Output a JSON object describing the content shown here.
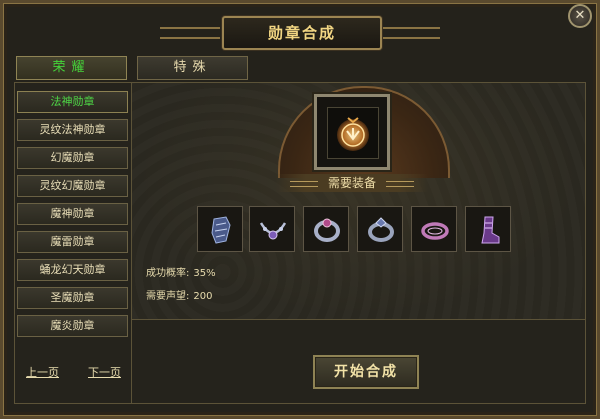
{
  "window": {
    "title": "勋章合成",
    "close_label": "✕"
  },
  "tabs": [
    {
      "label": "荣耀"
    },
    {
      "label": "特殊"
    }
  ],
  "medal_list": {
    "items": [
      {
        "label": "法神勋章"
      },
      {
        "label": "灵纹法神勋章"
      },
      {
        "label": "幻魔勋章"
      },
      {
        "label": "灵纹幻魔勋章"
      },
      {
        "label": "魔神勋章"
      },
      {
        "label": "魔雷勋章"
      },
      {
        "label": "蛹龙幻天勋章"
      },
      {
        "label": "圣魔勋章"
      },
      {
        "label": "魔炎勋章"
      }
    ],
    "prev_label": "上一页",
    "next_label": "下一页"
  },
  "craft": {
    "required_label": "需要装备",
    "required_items": [
      "bracer-icon",
      "necklace-icon",
      "ring-icon",
      "ring-icon",
      "ring-icon",
      "boots-icon"
    ],
    "success_rate_label": "成功概率:",
    "success_rate_value": "35%",
    "reputation_label": "需要声望:",
    "reputation_value": "200",
    "start_label": "开始合成"
  },
  "colors": {
    "accent_gold": "#f2d683",
    "selected_green": "#45d43a",
    "medal_glow": "#e8a84a"
  }
}
